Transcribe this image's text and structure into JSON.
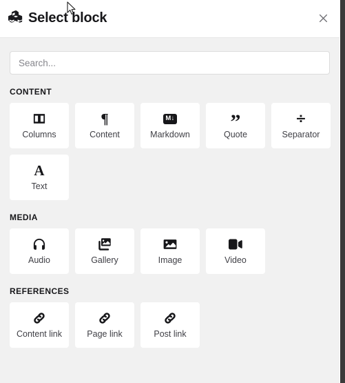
{
  "header": {
    "icon": "cubes-icon",
    "title": "Select block",
    "close_label": "×"
  },
  "search": {
    "placeholder": "Search...",
    "value": ""
  },
  "sections": [
    {
      "title": "CONTENT",
      "items": [
        {
          "label": "Columns",
          "icon": "columns-icon"
        },
        {
          "label": "Content",
          "icon": "pilcrow-icon"
        },
        {
          "label": "Markdown",
          "icon": "markdown-icon",
          "badge": "M↓"
        },
        {
          "label": "Quote",
          "icon": "quote-icon"
        },
        {
          "label": "Separator",
          "icon": "divide-icon"
        },
        {
          "label": "Text",
          "icon": "text-a-icon"
        }
      ]
    },
    {
      "title": "MEDIA",
      "items": [
        {
          "label": "Audio",
          "icon": "headphones-icon"
        },
        {
          "label": "Gallery",
          "icon": "images-stack-icon"
        },
        {
          "label": "Image",
          "icon": "image-icon"
        },
        {
          "label": "Video",
          "icon": "video-camera-icon"
        }
      ]
    },
    {
      "title": "REFERENCES",
      "items": [
        {
          "label": "Content link",
          "icon": "link-icon"
        },
        {
          "label": "Page link",
          "icon": "link-icon"
        },
        {
          "label": "Post link",
          "icon": "link-icon"
        }
      ]
    }
  ],
  "colors": {
    "panel_background": "#f1f1f1",
    "card_background": "#ffffff",
    "header_background": "#ffffff",
    "text_primary": "#17171a",
    "text_secondary": "#3f3f45",
    "placeholder": "#86868c",
    "edge_strip": "#3b3b3b"
  }
}
